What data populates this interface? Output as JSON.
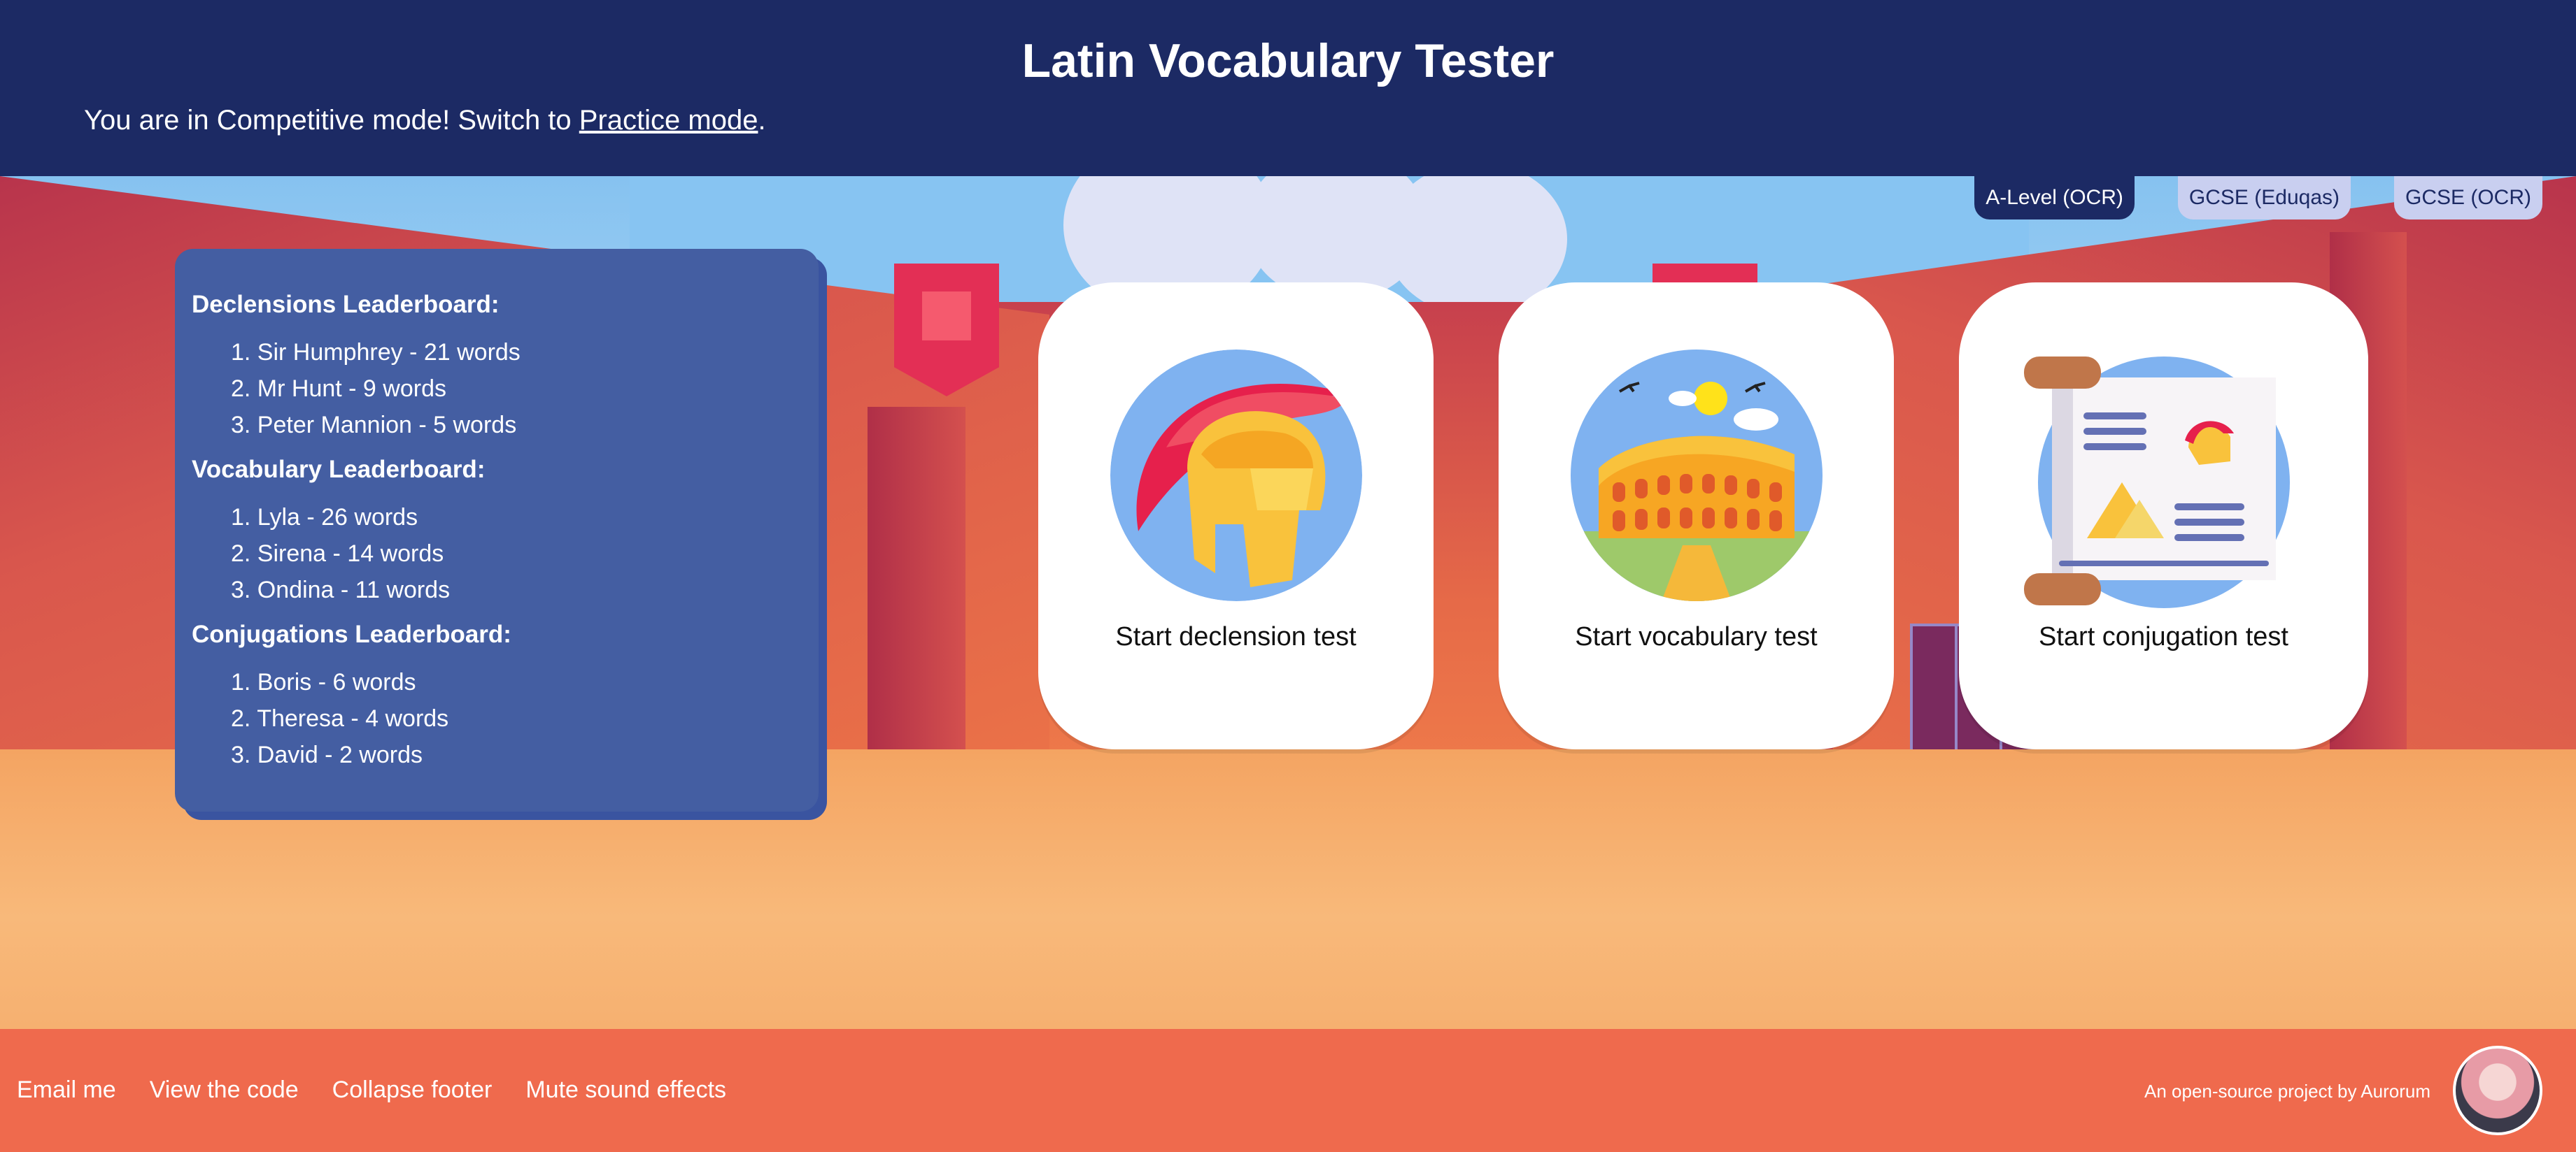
{
  "header": {
    "title": "Latin Vocabulary Tester",
    "mode_text_prefix": "You are in Competitive mode! Switch to ",
    "mode_link": "Practice mode",
    "mode_text_suffix": "."
  },
  "levels": [
    {
      "label": "A-Level (OCR)",
      "active": true
    },
    {
      "label": "GCSE (Eduqas)",
      "active": false
    },
    {
      "label": "GCSE (OCR)",
      "active": false
    }
  ],
  "leaderboards": [
    {
      "title": "Declensions Leaderboard:",
      "entries": [
        "1. Sir Humphrey - 21 words",
        "2. Mr Hunt - 9 words",
        "3. Peter Mannion - 5 words"
      ]
    },
    {
      "title": "Vocabulary Leaderboard:",
      "entries": [
        "1. Lyla - 26 words",
        "2. Sirena - 14 words",
        "3. Ondina - 11 words"
      ]
    },
    {
      "title": "Conjugations Leaderboard:",
      "entries": [
        "1. Boris - 6 words",
        "2. Theresa - 4 words",
        "3. David - 2 words"
      ]
    }
  ],
  "tests": [
    {
      "label": "Start declension test",
      "icon": "roman-helmet-icon"
    },
    {
      "label": "Start vocabulary test",
      "icon": "colosseum-icon"
    },
    {
      "label": "Start conjugation test",
      "icon": "scroll-icon"
    }
  ],
  "footer": {
    "links": [
      "Email me",
      "View the code",
      "Collapse footer",
      "Mute sound effects"
    ],
    "credit": "An open-source project by Aurorum"
  }
}
